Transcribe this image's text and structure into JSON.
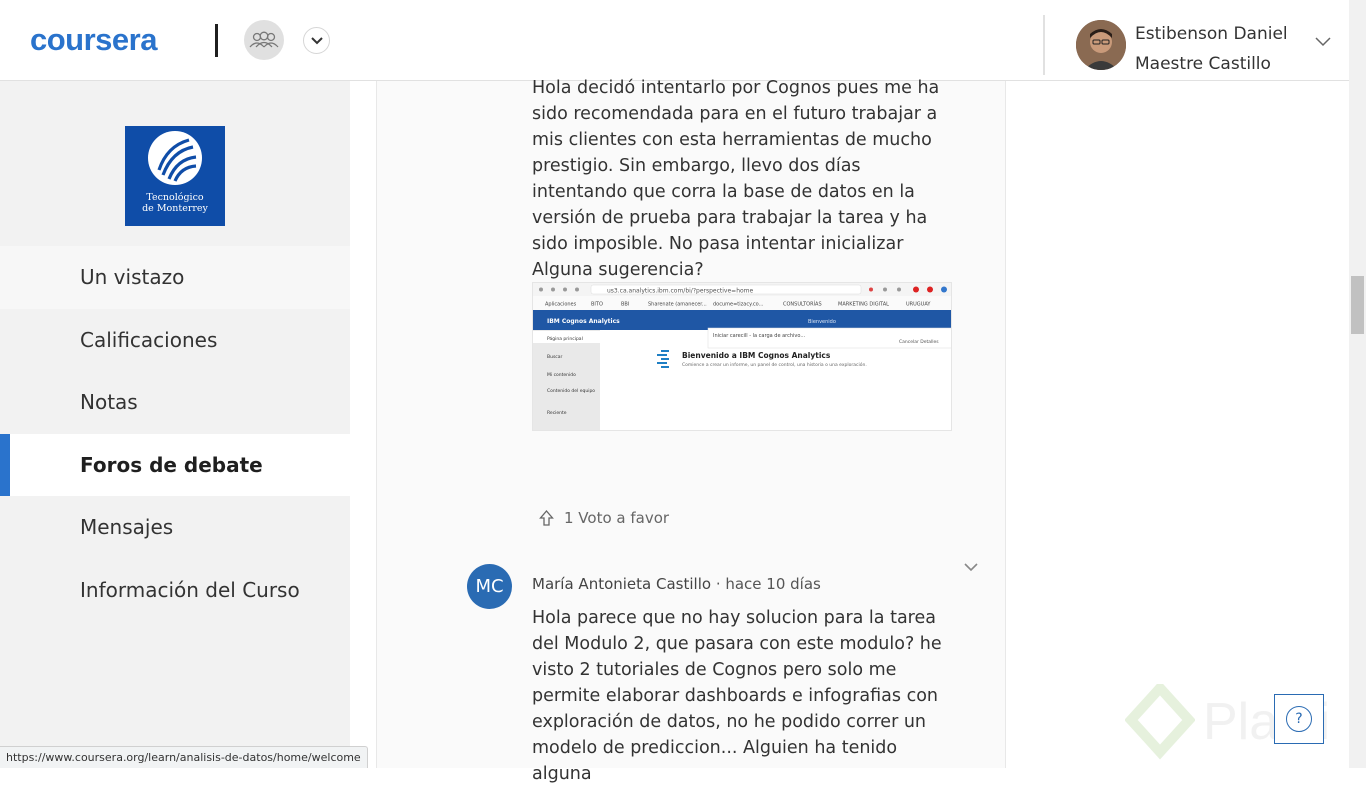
{
  "header": {
    "logo": "coursera",
    "user_name": "Estibenson Daniel Maestre Castillo"
  },
  "sidebar": {
    "school": {
      "line1": "Tecnológico",
      "line2": "de Monterrey"
    },
    "items": [
      {
        "label": "Un vistazo",
        "state": "highlight"
      },
      {
        "label": "Calificaciones",
        "state": "normal"
      },
      {
        "label": "Notas",
        "state": "normal"
      },
      {
        "label": "Foros de debate",
        "state": "active"
      },
      {
        "label": "Mensajes",
        "state": "normal"
      },
      {
        "label": "Información del Curso",
        "state": "normal"
      }
    ]
  },
  "status_url": "https://www.coursera.org/learn/analisis-de-datos/home/welcome",
  "post1": {
    "text": "Hola decidó intentarlo por Cognos pues me ha sido recomendada para en el futuro trabajar a mis clientes con esta herramientas de mucho prestigio. Sin embargo, llevo dos días intentando que corra la base de datos en la versión de prueba para trabajar la tarea y ha sido imposible. No pasa intentar inicializar Alguna sugerencia?",
    "vote_label": "1 Voto a favor",
    "embed": {
      "url": "us3.ca.analytics.ibm.com/bi/?perspective=home",
      "bookmarks": [
        "Aplicaciones",
        "BITO",
        "BBI",
        "Sharenate (amanecer...",
        "docume=tizacy.co...",
        "CONSULTORÍAS",
        "MARKETING DIGITAL",
        "URUGUAY"
      ],
      "app_title": "IBM Cognos Analytics",
      "banner_right": "Bienvenido",
      "search_hint": "Iniciar carecill - la carga de archivo...",
      "search_actions": "Cancelar  Detalles",
      "nav": [
        "Página principal",
        "Buscar",
        "Mi contenido",
        "Contenido del equipo",
        "Reciente"
      ],
      "welcome_title": "Bienvenido a IBM Cognos Analytics",
      "welcome_sub": "Comience a crear un informe, un panel de control, una historia o una exploración."
    }
  },
  "post2": {
    "initials": "MC",
    "author": "María Antonieta Castillo",
    "time": " · hace 10 días",
    "text": "Hola parece que no hay solucion para la tarea del Modulo 2, que pasara con este modulo? he visto 2 tutoriales de Cognos pero solo me permite elaborar dashboards e infografias con exploración de datos, no he podido correr un modelo de prediccion... Alguien ha tenido alguna"
  },
  "help_label": "?",
  "watermark": "Platzi",
  "colors": {
    "brand": "#2a73cc",
    "sidebar_bg": "#f2f2f2",
    "avatar_bg": "#2a6bb3"
  }
}
